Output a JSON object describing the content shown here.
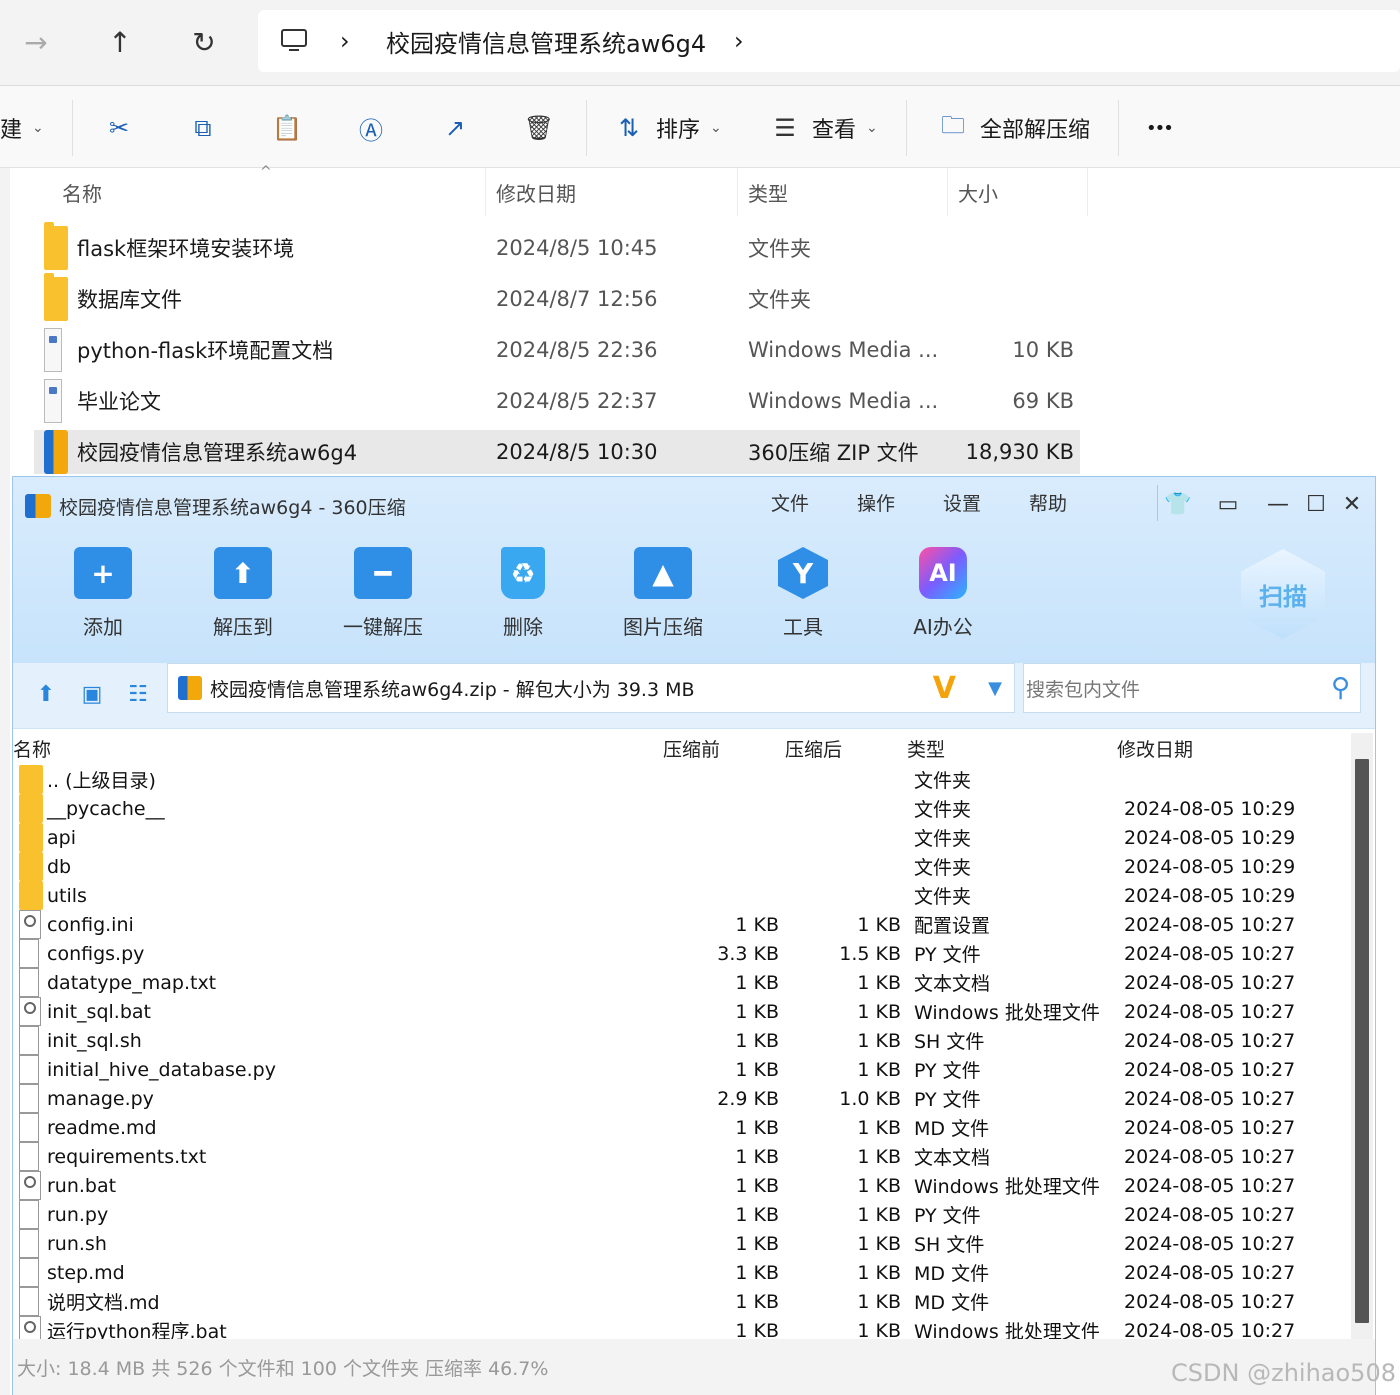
{
  "explorer": {
    "nav": {
      "forward_icon": "arrow-right-icon",
      "up_icon": "arrow-up-icon",
      "refresh_icon": "refresh-icon"
    },
    "breadcrumb": {
      "pc_icon": "monitor-icon",
      "folder": "校园疫情信息管理系统aw6g4",
      "sep": "›"
    },
    "toolbar": {
      "new_label": "建",
      "sort_label": "排序",
      "view_label": "查看",
      "extract_all_label": "全部解压缩",
      "more_label": "•••"
    },
    "columns": {
      "name": "名称",
      "modified": "修改日期",
      "type": "类型",
      "size": "大小"
    },
    "files": [
      {
        "name": "flask框架环境安装环境",
        "modified": "2024/8/5 10:45",
        "type": "文件夹",
        "size": "",
        "icon": "folder-icon"
      },
      {
        "name": "数据库文件",
        "modified": "2024/8/7 12:56",
        "type": "文件夹",
        "size": "",
        "icon": "folder-icon"
      },
      {
        "name": "python-flask环境配置文档",
        "modified": "2024/8/5 22:36",
        "type": "Windows Media ...",
        "size": "10 KB",
        "icon": "media-file-icon"
      },
      {
        "name": "毕业论文",
        "modified": "2024/8/5 22:37",
        "type": "Windows Media ...",
        "size": "69 KB",
        "icon": "media-file-icon"
      },
      {
        "name": "校园疫情信息管理系统aw6g4",
        "modified": "2024/8/5 10:30",
        "type": "360压缩 ZIP 文件",
        "size": "18,930 KB",
        "icon": "zip-icon"
      }
    ]
  },
  "archiver": {
    "title": "校园疫情信息管理系统aw6g4 - 360压缩",
    "menu": [
      "文件",
      "操作",
      "设置",
      "帮助"
    ],
    "tools": [
      {
        "label": "添加",
        "icon": "add-folder-icon",
        "color": "#2f8fe6"
      },
      {
        "label": "解压到",
        "icon": "extract-folder-icon",
        "color": "#2f8fe6"
      },
      {
        "label": "一键解压",
        "icon": "one-click-extract-icon",
        "color": "#2f8fe6"
      },
      {
        "label": "删除",
        "icon": "recycle-bin-icon",
        "color": "#39a8f0"
      },
      {
        "label": "图片压缩",
        "icon": "image-compress-icon",
        "color": "#2f8fe6"
      },
      {
        "label": "工具",
        "icon": "tools-hexagon-icon",
        "color": "#2f8fe6"
      },
      {
        "label": "AI办公",
        "icon": "ai-office-icon",
        "color": "#a64bf4"
      }
    ],
    "scan_label": "扫描",
    "path_text": "校园疫情信息管理系统aw6g4.zip - 解包大小为 39.3 MB",
    "search_placeholder": "搜索包内文件",
    "columns": {
      "name": "名称",
      "before": "压缩前",
      "after": "压缩后",
      "type": "类型",
      "modified": "修改日期"
    },
    "entries": [
      {
        "name": ".. (上级目录)",
        "before": "",
        "after": "",
        "type": "文件夹",
        "modified": "",
        "icon": "folder-icon"
      },
      {
        "name": "__pycache__",
        "before": "",
        "after": "",
        "type": "文件夹",
        "modified": "2024-08-05 10:29",
        "icon": "folder-icon"
      },
      {
        "name": "api",
        "before": "",
        "after": "",
        "type": "文件夹",
        "modified": "2024-08-05 10:29",
        "icon": "folder-icon"
      },
      {
        "name": "db",
        "before": "",
        "after": "",
        "type": "文件夹",
        "modified": "2024-08-05 10:29",
        "icon": "folder-icon"
      },
      {
        "name": "utils",
        "before": "",
        "after": "",
        "type": "文件夹",
        "modified": "2024-08-05 10:29",
        "icon": "folder-icon"
      },
      {
        "name": "config.ini",
        "before": "1 KB",
        "after": "1 KB",
        "type": "配置设置",
        "modified": "2024-08-05 10:27",
        "icon": "settings-file-icon"
      },
      {
        "name": "configs.py",
        "before": "3.3 KB",
        "after": "1.5 KB",
        "type": "PY 文件",
        "modified": "2024-08-05 10:27",
        "icon": "file-icon"
      },
      {
        "name": "datatype_map.txt",
        "before": "1 KB",
        "after": "1 KB",
        "type": "文本文档",
        "modified": "2024-08-05 10:27",
        "icon": "text-file-icon"
      },
      {
        "name": "init_sql.bat",
        "before": "1 KB",
        "after": "1 KB",
        "type": "Windows 批处理文件",
        "modified": "2024-08-05 10:27",
        "icon": "batch-file-icon"
      },
      {
        "name": "init_sql.sh",
        "before": "1 KB",
        "after": "1 KB",
        "type": "SH 文件",
        "modified": "2024-08-05 10:27",
        "icon": "file-icon"
      },
      {
        "name": "initial_hive_database.py",
        "before": "1 KB",
        "after": "1 KB",
        "type": "PY 文件",
        "modified": "2024-08-05 10:27",
        "icon": "file-icon"
      },
      {
        "name": "manage.py",
        "before": "2.9 KB",
        "after": "1.0 KB",
        "type": "PY 文件",
        "modified": "2024-08-05 10:27",
        "icon": "file-icon"
      },
      {
        "name": "readme.md",
        "before": "1 KB",
        "after": "1 KB",
        "type": "MD 文件",
        "modified": "2024-08-05 10:27",
        "icon": "file-icon"
      },
      {
        "name": "requirements.txt",
        "before": "1 KB",
        "after": "1 KB",
        "type": "文本文档",
        "modified": "2024-08-05 10:27",
        "icon": "text-file-icon"
      },
      {
        "name": "run.bat",
        "before": "1 KB",
        "after": "1 KB",
        "type": "Windows 批处理文件",
        "modified": "2024-08-05 10:27",
        "icon": "batch-file-icon"
      },
      {
        "name": "run.py",
        "before": "1 KB",
        "after": "1 KB",
        "type": "PY 文件",
        "modified": "2024-08-05 10:27",
        "icon": "file-icon"
      },
      {
        "name": "run.sh",
        "before": "1 KB",
        "after": "1 KB",
        "type": "SH 文件",
        "modified": "2024-08-05 10:27",
        "icon": "file-icon"
      },
      {
        "name": "step.md",
        "before": "1 KB",
        "after": "1 KB",
        "type": "MD 文件",
        "modified": "2024-08-05 10:27",
        "icon": "file-icon"
      },
      {
        "name": "说明文档.md",
        "before": "1 KB",
        "after": "1 KB",
        "type": "MD 文件",
        "modified": "2024-08-05 10:27",
        "icon": "file-icon"
      },
      {
        "name": "运行python程序.bat",
        "before": "1 KB",
        "after": "1 KB",
        "type": "Windows 批处理文件",
        "modified": "2024-08-05 10:27",
        "icon": "batch-file-icon"
      }
    ],
    "status": "大小: 18.4 MB 共 526 个文件和 100 个文件夹 压缩率 46.7%"
  },
  "watermark": "CSDN @zhihao508"
}
